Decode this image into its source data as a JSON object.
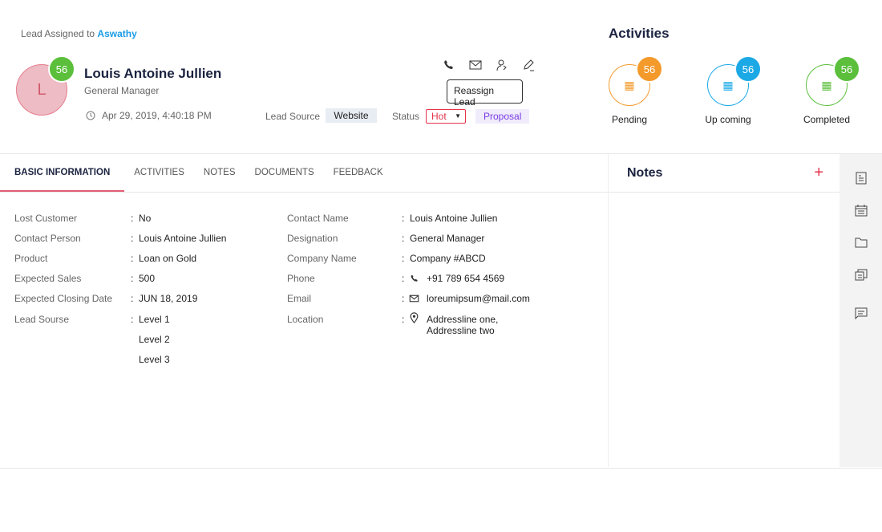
{
  "header": {
    "assigned_prefix": "Lead Assigned to",
    "assigned_to": "Aswathy",
    "avatar_letter": "L",
    "score": "56",
    "name": "Louis Antoine Jullien",
    "role": "General Manager",
    "date": "Apr 29, 2019, 4:40:18 PM",
    "lead_source_label": "Lead Source",
    "lead_source": "Website",
    "status_label": "Status",
    "status": "Hot",
    "stage": "Proposal",
    "tooltip": "Reassign Lead"
  },
  "activities": {
    "title": "Activities",
    "items": [
      {
        "label": "Pending",
        "count": "56",
        "color": "#f39a2b"
      },
      {
        "label": "Up coming",
        "count": "56",
        "color": "#1ba9e6"
      },
      {
        "label": "Completed",
        "count": "56",
        "color": "#5bbf3c"
      }
    ]
  },
  "tabs": [
    "BASIC INFORMATION",
    "ACTIVITIES",
    "NOTES",
    "DOCUMENTS",
    "FEEDBACK"
  ],
  "left_fields": [
    {
      "label": "Lost Customer",
      "value": "No"
    },
    {
      "label": "Contact  Person",
      "value": "Louis Antoine Jullien"
    },
    {
      "label": "Product",
      "value": "Loan on Gold"
    },
    {
      "label": "Expected Sales",
      "value": "500"
    },
    {
      "label": "Expected Closing Date",
      "value": "JUN 18, 2019"
    },
    {
      "label": "Lead Sourse",
      "value": "Level 1",
      "extra": [
        "Level  2",
        "Level 3"
      ]
    }
  ],
  "right_fields": [
    {
      "label": "Contact Name",
      "value": "Louis Antoine Jullien"
    },
    {
      "label": "Designation",
      "value": "General Manager"
    },
    {
      "label": "Company Name",
      "value": "Company #ABCD"
    },
    {
      "label": "Phone",
      "value": "+91 789 654 4569",
      "icon": "phone-icon"
    },
    {
      "label": "Email",
      "value": "loreumipsum@mail.com",
      "icon": "mail-icon"
    },
    {
      "label": "Location",
      "value": "Addressline one,",
      "value2": "Addressline two",
      "icon": "location-pin-icon"
    }
  ],
  "notes": {
    "title": "Notes",
    "add": "+"
  }
}
